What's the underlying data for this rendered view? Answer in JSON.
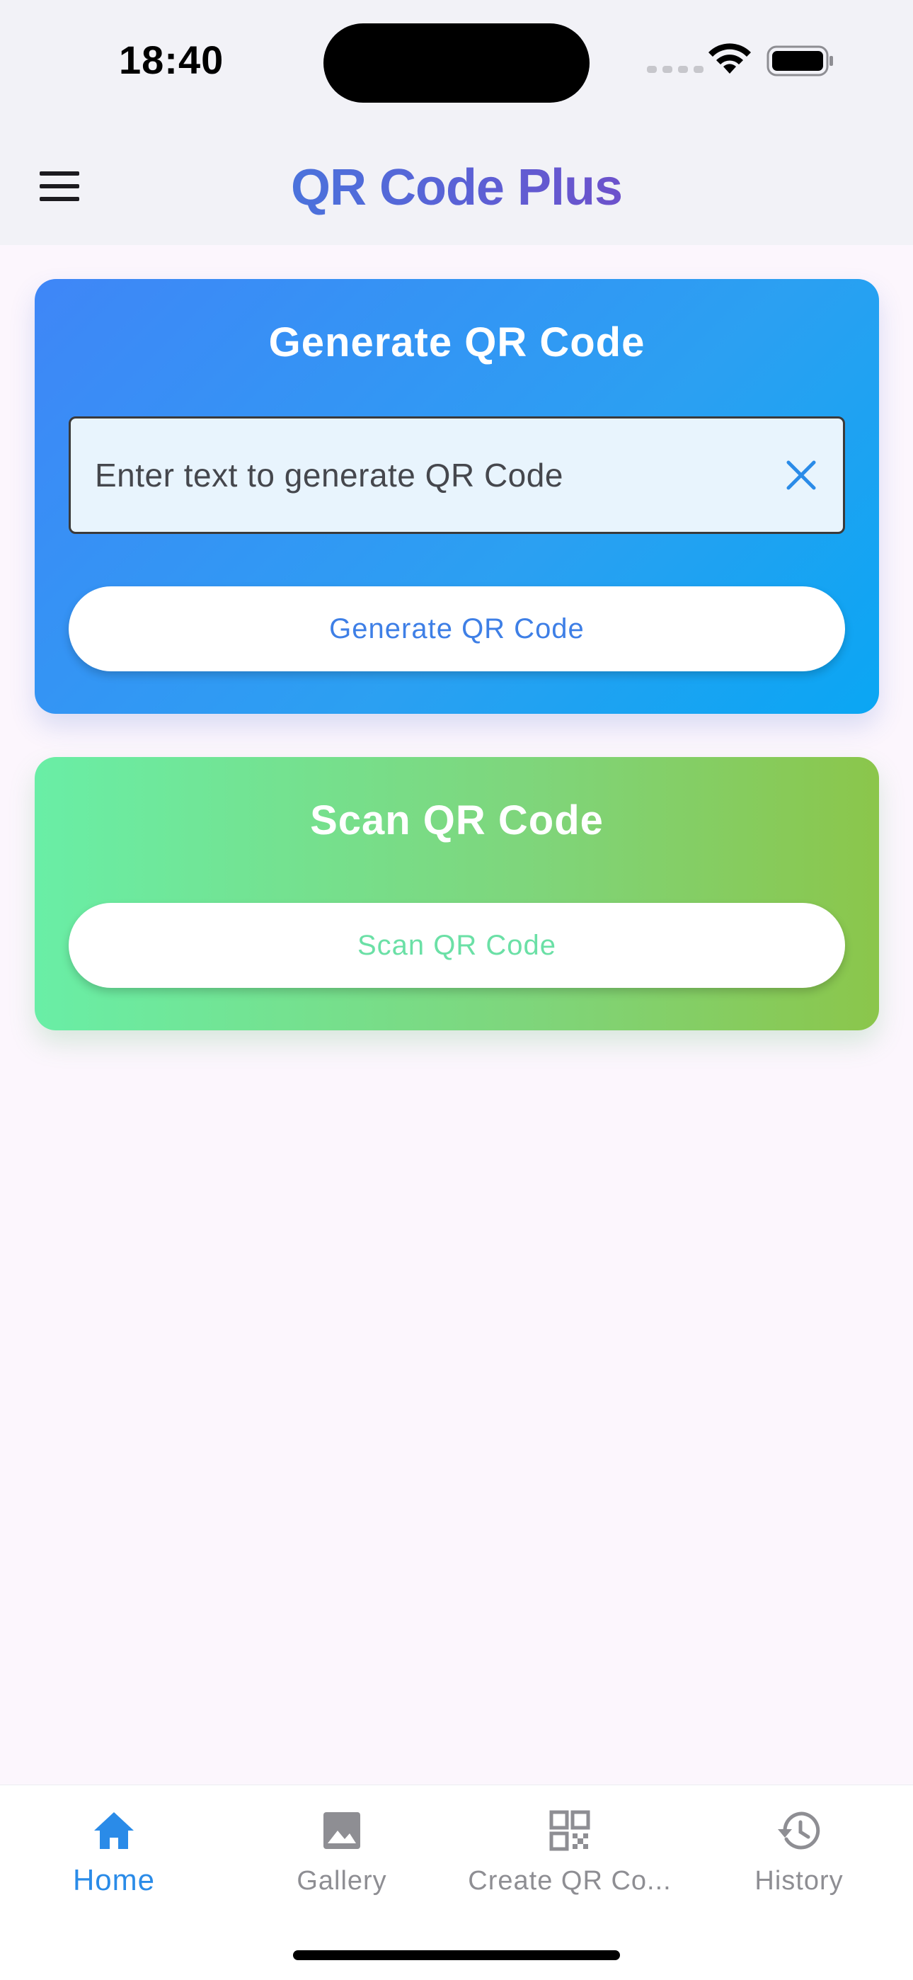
{
  "status_bar": {
    "time": "18:40"
  },
  "app_bar": {
    "title": "QR Code Plus",
    "menu_icon": "hamburger-menu-icon",
    "title_gradient": [
      "#2f8fe6",
      "#8e35b8"
    ]
  },
  "generate_card": {
    "title": "Generate QR Code",
    "input": {
      "value": "",
      "placeholder": "Enter text to generate QR Code"
    },
    "clear_icon": "close-icon",
    "button_label": "Generate QR Code",
    "gradient": [
      "#3f86f7",
      "#0aa6f3"
    ]
  },
  "scan_card": {
    "title": "Scan QR Code",
    "button_label": "Scan QR Code",
    "gradient": [
      "#69eea6",
      "#8bc64b"
    ]
  },
  "bottom_nav": {
    "items": [
      {
        "label": "Home",
        "icon": "home-icon",
        "active": true
      },
      {
        "label": "Gallery",
        "icon": "image-icon",
        "active": false
      },
      {
        "label": "Create QR Co...",
        "icon": "qr-code-icon",
        "active": false
      },
      {
        "label": "History",
        "icon": "history-icon",
        "active": false
      }
    ],
    "active_color": "#2a8be8",
    "inactive_color": "#8e8e93"
  }
}
